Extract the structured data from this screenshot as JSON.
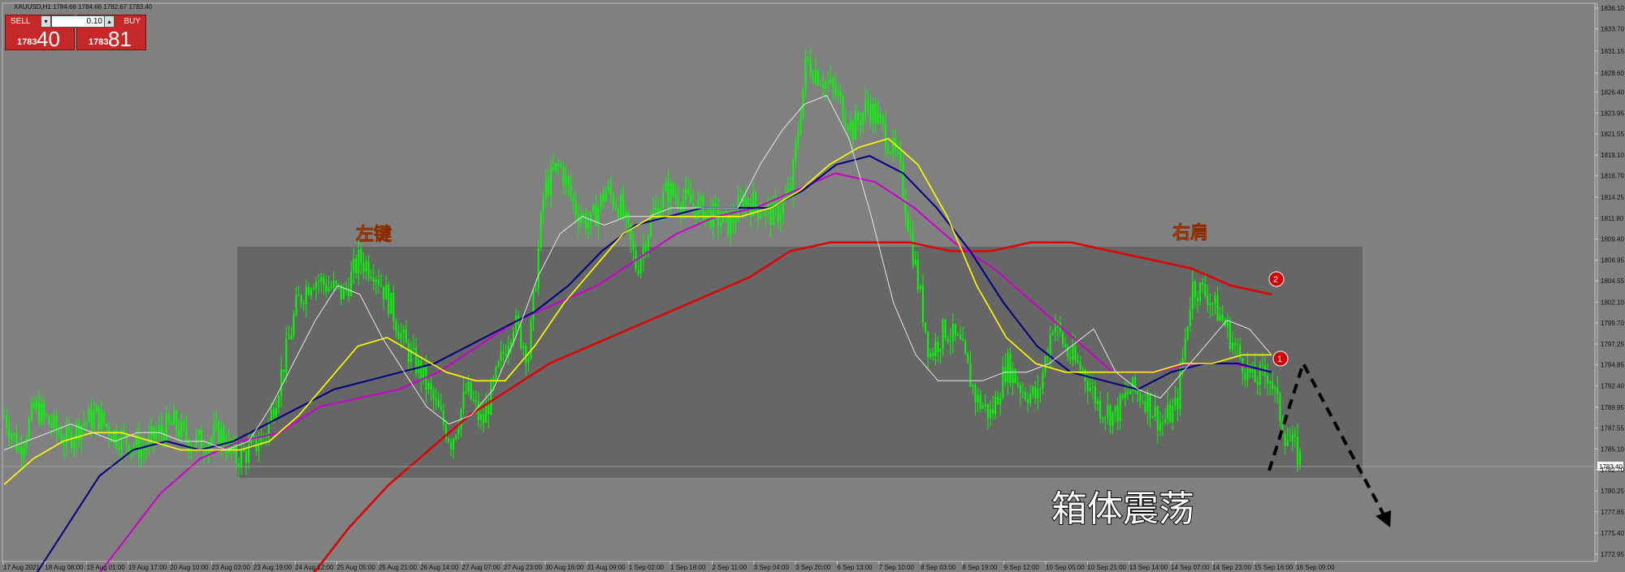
{
  "header": {
    "symbol_info": "XAUUSD,H1",
    "ohlc": "1784.66 1784.66 1782.67 1783.40"
  },
  "trade_panel": {
    "sell_label": "SELL",
    "buy_label": "BUY",
    "lot": "0.10",
    "sell_price_prefix": "1783",
    "sell_price_big": "40",
    "buy_price_prefix": "1783",
    "buy_price_big": "81"
  },
  "annotations": {
    "left_shoulder": "左键",
    "right_shoulder": "右肩",
    "box_label": "箱体震荡",
    "marker_1": "1",
    "marker_2": "2"
  },
  "current_price_label": "1783.40",
  "colors": {
    "background": "#808080",
    "candle": "#00ff00",
    "ma_white": "#e6e6e6",
    "ma_yellow": "#ffff00",
    "ma_navy": "#000080",
    "ma_magenta": "#cc00cc",
    "ma_red": "#e00000",
    "box": "#666666",
    "annotation_text": "#ff9900"
  },
  "chart_data": {
    "type": "candlestick",
    "title": "",
    "y_ticks": [
      "1836.10",
      "1833.70",
      "1831.15",
      "1828.60",
      "1826.40",
      "1823.95",
      "1821.55",
      "1819.10",
      "1816.70",
      "1814.25",
      "1811.80",
      "1809.40",
      "1806.95",
      "1804.55",
      "1802.10",
      "1799.70",
      "1797.25",
      "1794.85",
      "1792.40",
      "1789.95",
      "1787.55",
      "1785.10",
      "1782.70",
      "1780.25",
      "1777.85",
      "1775.40",
      "1772.95"
    ],
    "ylim": [
      1772.95,
      1836.1
    ],
    "x_ticks": [
      "17 Aug 2021",
      "18 Aug 08:00",
      "19 Aug 01:00",
      "19 Aug 17:00",
      "20 Aug 10:00",
      "23 Aug 03:00",
      "23 Aug 19:00",
      "24 Aug 12:00",
      "25 Aug 05:00",
      "25 Aug 21:00",
      "26 Aug 14:00",
      "27 Aug 07:00",
      "27 Aug 23:00",
      "30 Aug 16:00",
      "31 Aug 09:00",
      "1 Sep 02:00",
      "1 Sep 18:00",
      "2 Sep 11:00",
      "3 Sep 04:00",
      "3 Sep 20:00",
      "6 Sep 13:00",
      "7 Sep 10:00",
      "8 Sep 03:00",
      "8 Sep 19:00",
      "9 Sep 12:00",
      "10 Sep 05:00",
      "10 Sep 21:00",
      "13 Sep 14:00",
      "14 Sep 07:00",
      "14 Sep 23:00",
      "15 Sep 16:00",
      "16 Sep 09:00"
    ],
    "close_path": [
      1789,
      1785,
      1790,
      1788,
      1786,
      1788,
      1789,
      1787,
      1786,
      1785,
      1787,
      1788,
      1786,
      1786,
      1787,
      1784,
      1785,
      1787,
      1794,
      1802,
      1805,
      1804,
      1803,
      1807,
      1806,
      1802,
      1797,
      1794,
      1790,
      1786,
      1792,
      1788,
      1794,
      1800,
      1796,
      1815,
      1818,
      1813,
      1811,
      1815,
      1813,
      1806,
      1812,
      1815,
      1814,
      1813,
      1812,
      1811,
      1814,
      1813,
      1812,
      1815,
      1830,
      1828,
      1826,
      1822,
      1825,
      1822,
      1818,
      1807,
      1796,
      1799,
      1797,
      1791,
      1789,
      1795,
      1792,
      1791,
      1800,
      1796,
      1794,
      1790,
      1789,
      1792,
      1791,
      1788,
      1790,
      1804,
      1803,
      1800,
      1796,
      1793,
      1794,
      1787,
      1784
    ],
    "ma_white": [
      1785,
      1786,
      1787,
      1788,
      1787,
      1786,
      1787,
      1787,
      1786,
      1786,
      1785,
      1786,
      1790,
      1795,
      1800,
      1804,
      1803,
      1798,
      1794,
      1790,
      1788,
      1789,
      1792,
      1798,
      1805,
      1810,
      1812,
      1811,
      1812,
      1812,
      1813,
      1813,
      1813,
      1813,
      1818,
      1822,
      1825,
      1826,
      1821,
      1812,
      1802,
      1796,
      1793,
      1793,
      1793,
      1794,
      1794,
      1795,
      1797,
      1799,
      1794,
      1792,
      1791,
      1794,
      1797,
      1800,
      1799,
      1796
    ],
    "ma_yellow": [
      1781,
      1784,
      1786,
      1787,
      1787,
      1786,
      1785,
      1785,
      1785,
      1786,
      1789,
      1793,
      1797,
      1798,
      1796,
      1794,
      1793,
      1793,
      1797,
      1802,
      1806,
      1810,
      1812,
      1812,
      1812,
      1812,
      1813,
      1815,
      1818,
      1820,
      1821,
      1818,
      1812,
      1804,
      1798,
      1795,
      1794,
      1794,
      1794,
      1794,
      1795,
      1795,
      1796,
      1796
    ],
    "ma_navy": [
      1770,
      1776,
      1782,
      1785,
      1786,
      1785,
      1786,
      1788,
      1790,
      1792,
      1793,
      1794,
      1795,
      1797,
      1799,
      1801,
      1804,
      1808,
      1811,
      1812,
      1813,
      1813,
      1813,
      1815,
      1818,
      1819,
      1817,
      1813,
      1808,
      1802,
      1797,
      1794,
      1793,
      1792,
      1794,
      1795,
      1795,
      1794
    ],
    "ma_magenta": [
      1768,
      1774,
      1780,
      1784,
      1786,
      1787,
      1790,
      1791,
      1792,
      1794,
      1797,
      1800,
      1802,
      1804,
      1807,
      1810,
      1812,
      1813,
      1815,
      1817,
      1816,
      1813,
      1809,
      1806,
      1802,
      1798,
      1794,
      1794,
      1795,
      1795,
      1794
    ],
    "ma_red": [
      1770,
      1776,
      1781,
      1785,
      1789,
      1792,
      1795,
      1797,
      1799,
      1801,
      1803,
      1805,
      1808,
      1809,
      1809,
      1809,
      1808,
      1808,
      1809,
      1809,
      1808,
      1807,
      1806,
      1804,
      1803
    ],
    "box_range": [
      1782.7,
      1809.4
    ],
    "arrow": "projected move up then down"
  }
}
